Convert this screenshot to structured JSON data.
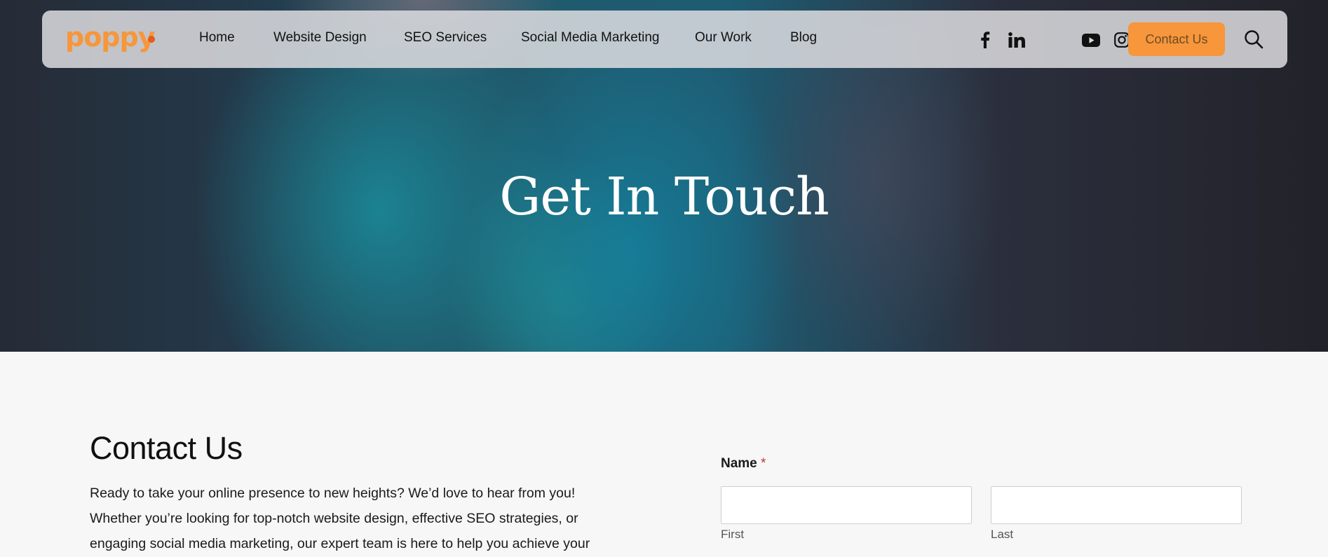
{
  "brand": {
    "logo_text": "poppy",
    "logo_color": "#f7963a",
    "dot_color": "#e85a1d"
  },
  "nav": {
    "links": [
      {
        "label": "Home"
      },
      {
        "label": "Website Design"
      },
      {
        "label": "SEO Services"
      },
      {
        "label": "Social Media Marketing"
      },
      {
        "label": "Our Work"
      },
      {
        "label": "Blog"
      }
    ],
    "social_icons": [
      "facebook-icon",
      "linkedin-icon",
      "youtube-icon",
      "instagram-icon"
    ],
    "cta_label": "Contact Us",
    "cta_color": "#f7963a",
    "search_icon": "search-icon"
  },
  "hero": {
    "title": "Get In Touch"
  },
  "contact": {
    "heading": "Contact Us",
    "intro": "Ready to take your online presence to new heights? We’d love to hear from you! Whether you’re looking for top-notch website design, effective SEO strategies, or engaging social media marketing, our expert team is here to help you achieve your"
  },
  "form": {
    "name_label": "Name",
    "required_mark": "*",
    "first_value": "",
    "last_value": "",
    "first_label": "First",
    "last_label": "Last"
  }
}
